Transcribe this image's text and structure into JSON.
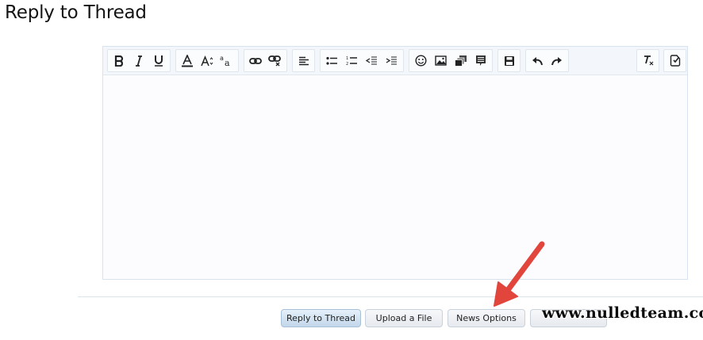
{
  "page": {
    "title": "Reply to Thread"
  },
  "editor": {
    "content": "",
    "toolbar_groups": [
      [
        "bold-icon",
        "italic-icon",
        "underline-icon"
      ],
      [
        "text-color-icon",
        "font-size-icon",
        "font-family-icon"
      ],
      [
        "link-icon",
        "unlink-icon"
      ],
      [
        "align-left-icon"
      ],
      [
        "bullet-list-icon",
        "numbered-list-icon",
        "outdent-icon",
        "indent-icon"
      ],
      [
        "smilie-icon",
        "image-icon",
        "media-icon",
        "quote-icon"
      ],
      [
        "save-draft-icon"
      ],
      [
        "undo-icon",
        "redo-icon"
      ],
      [
        "remove-format-icon"
      ],
      [
        "toggle-bbcode-icon"
      ]
    ]
  },
  "buttons": {
    "reply": "Reply to Thread",
    "upload": "Upload a File",
    "news_options": "News Options"
  },
  "watermark": "www.nulledteam.com",
  "colors": {
    "primary_button": "#c2d7ea",
    "arrow": "#e2453c",
    "editor_border": "#d7e3ee"
  }
}
